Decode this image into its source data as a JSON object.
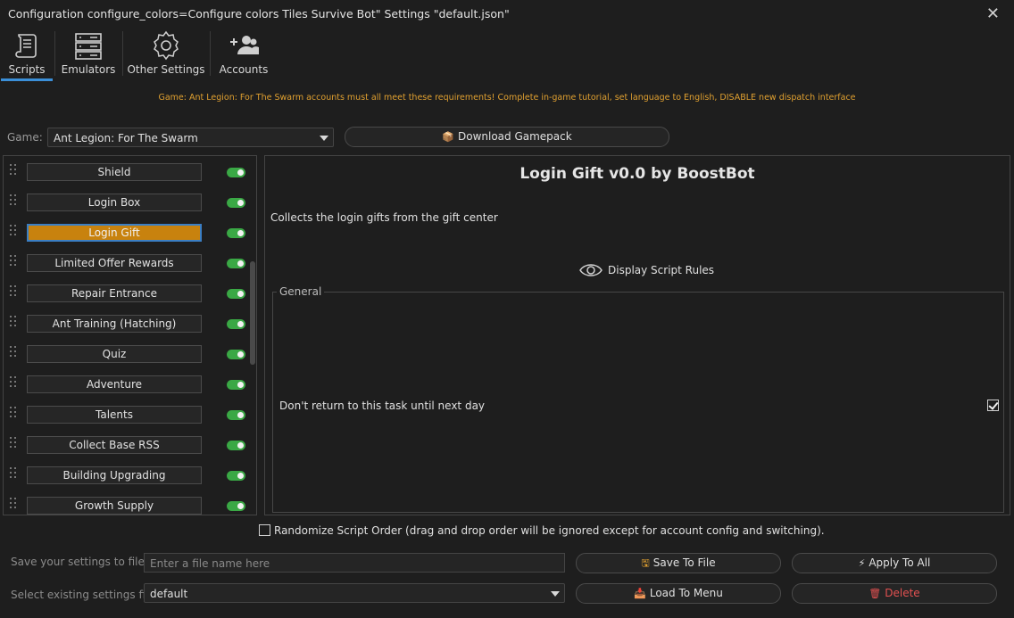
{
  "window": {
    "title": "Configuration configure_colors=Configure colors Tiles Survive Bot\" Settings \"default.json\"",
    "close_icon": "close-icon"
  },
  "toolbar": {
    "tabs": [
      {
        "label": "Scripts",
        "icon": "scroll-icon",
        "active": true
      },
      {
        "label": "Emulators",
        "icon": "server-icon",
        "active": false
      },
      {
        "label": "Other Settings",
        "icon": "gear-icon",
        "active": false
      },
      {
        "label": "Accounts",
        "icon": "add-user-icon",
        "active": false
      }
    ],
    "accent_color": "#3b8fd8"
  },
  "notice": {
    "text": "Game: Ant Legion: For The Swarm accounts must all meet these requirements! Complete in-game tutorial, set language to English, DISABLE new dispatch interface",
    "color": "#e0a030"
  },
  "game": {
    "label": "Game:",
    "selected": "Ant Legion: For The Swarm",
    "download_label": "Download Gamepack",
    "download_icon": "package-icon"
  },
  "scripts": {
    "items": [
      {
        "label": "Shield",
        "enabled": true,
        "active": false
      },
      {
        "label": "Login Box",
        "enabled": true,
        "active": false
      },
      {
        "label": "Login Gift",
        "enabled": true,
        "active": true
      },
      {
        "label": "Limited Offer Rewards",
        "enabled": true,
        "active": false
      },
      {
        "label": "Repair Entrance",
        "enabled": true,
        "active": false
      },
      {
        "label": "Ant Training (Hatching)",
        "enabled": true,
        "active": false
      },
      {
        "label": "Quiz",
        "enabled": true,
        "active": false
      },
      {
        "label": "Adventure",
        "enabled": true,
        "active": false
      },
      {
        "label": "Talents",
        "enabled": true,
        "active": false
      },
      {
        "label": "Collect Base RSS",
        "enabled": true,
        "active": false
      },
      {
        "label": "Building Upgrading",
        "enabled": true,
        "active": false
      },
      {
        "label": "Growth Supply",
        "enabled": true,
        "active": false
      }
    ],
    "active_color": "#c8820e",
    "toggle_color": "#3aa845"
  },
  "detail": {
    "title": "Login Gift v0.0 by BoostBot",
    "description": "Collects the login gifts from the gift center",
    "rules_label": "Display Script Rules",
    "rules_icon": "eye-icon",
    "group_title": "General",
    "options": [
      {
        "label": "Don't return to this task until next day",
        "checked": true
      }
    ]
  },
  "randomize": {
    "label": "Randomize Script Order (drag and drop order will be ignored except for account config and switching).",
    "checked": false
  },
  "settings": {
    "save_label": "Save your settings to file",
    "save_placeholder": "Enter a file name here",
    "save_button": "Save To File",
    "save_icon": "floppy-icon",
    "apply_button": "Apply To All",
    "apply_icon": "lightning-icon",
    "select_label": "Select existing settings file",
    "selected_file": "default",
    "load_button": "Load To Menu",
    "load_icon": "tray-icon",
    "delete_button": "Delete",
    "delete_icon": "trash-icon",
    "delete_color": "#e25151"
  }
}
